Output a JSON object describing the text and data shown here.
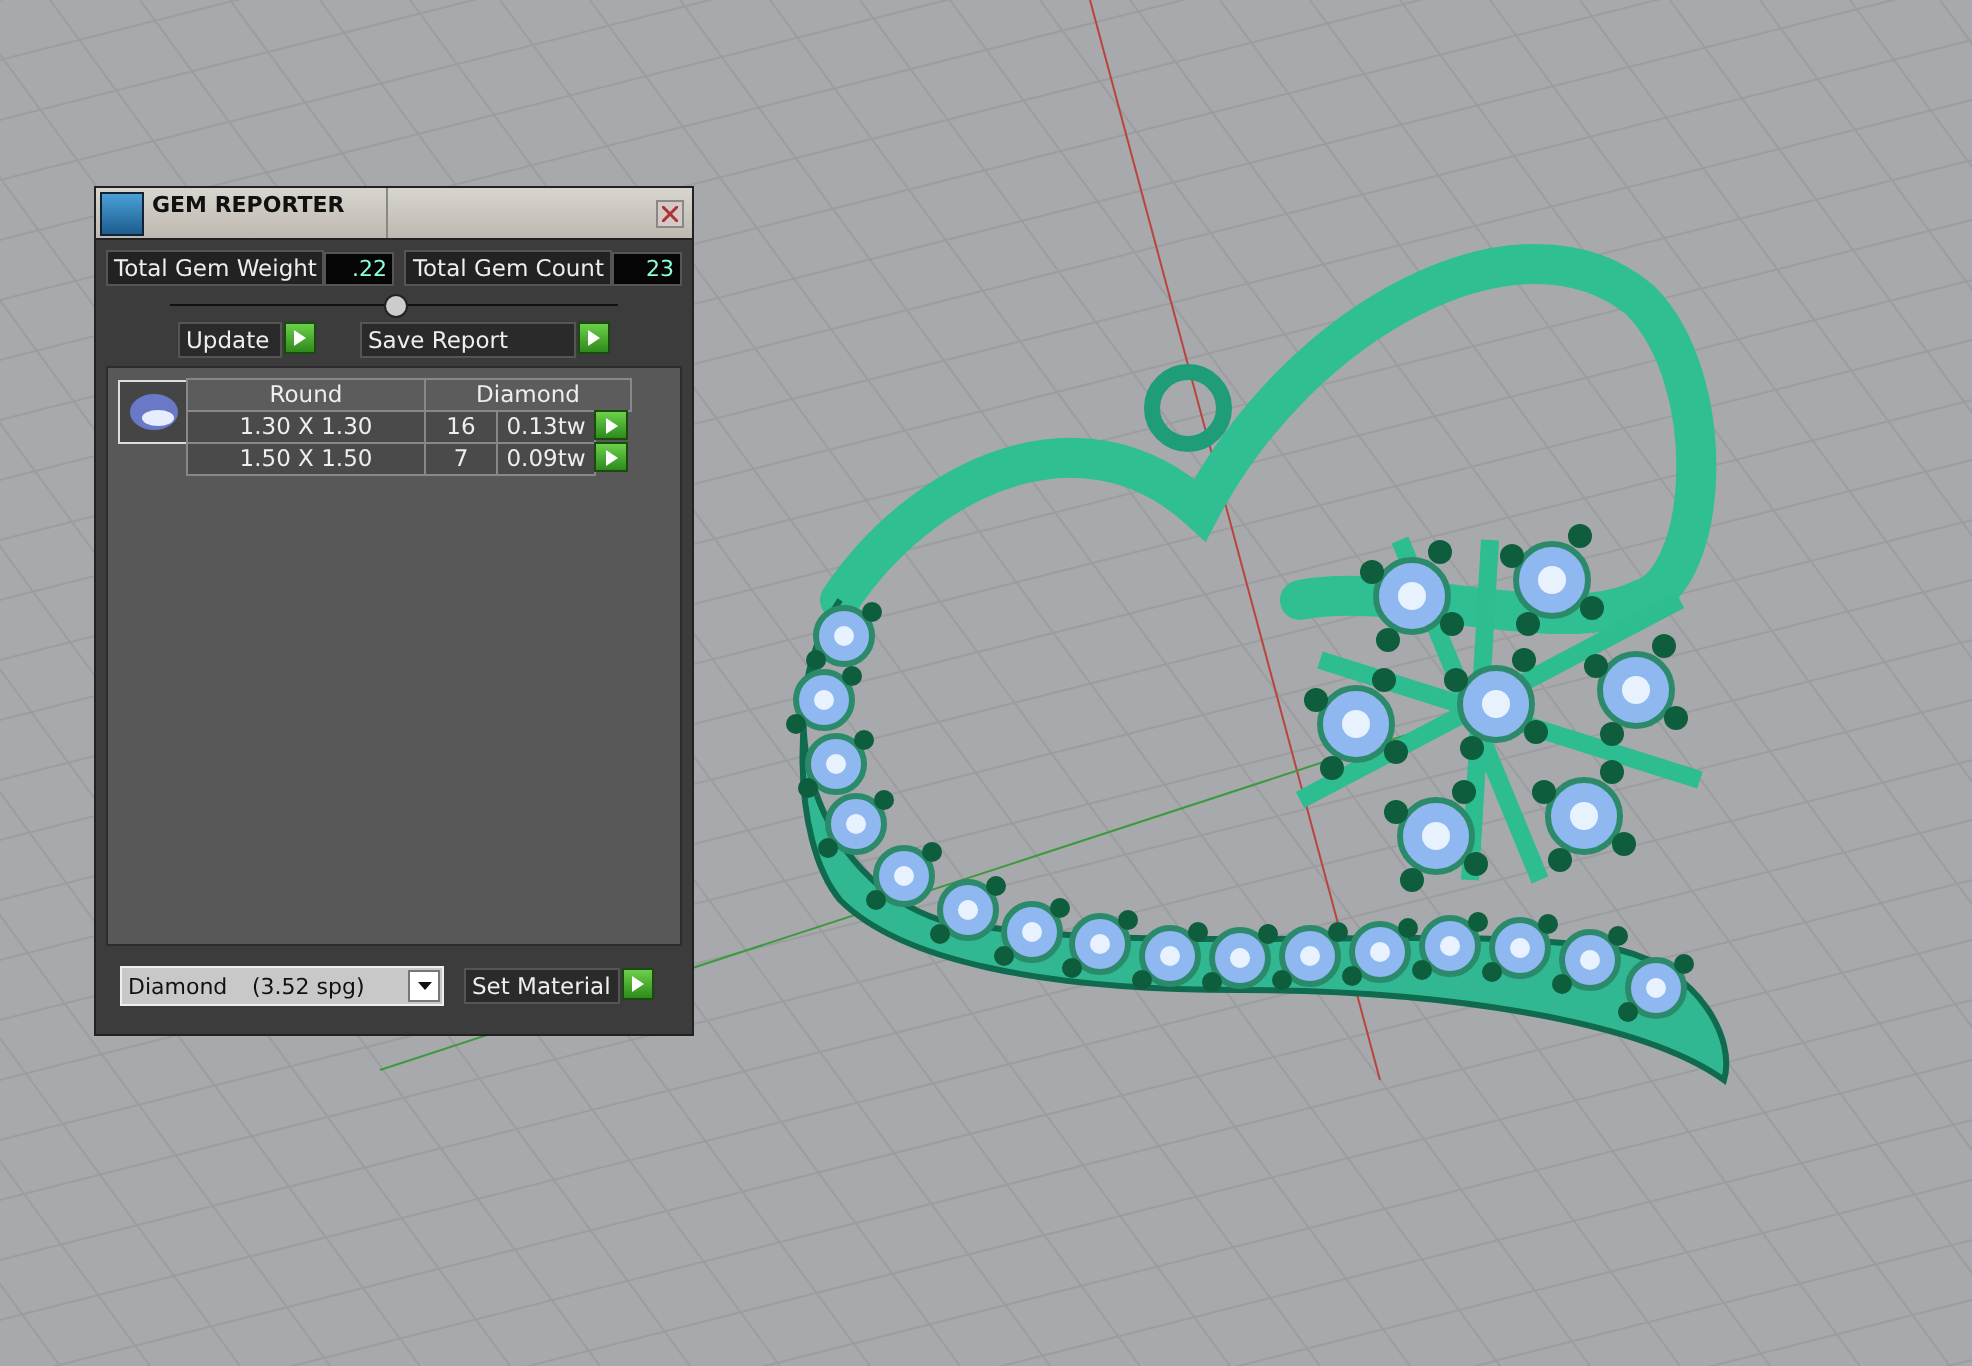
{
  "panel": {
    "title": "GEM REPORTER",
    "stats": [
      {
        "label": "Total Gem Weight",
        "value": ".22"
      },
      {
        "label": "Total Gem Count",
        "value": "23"
      }
    ],
    "actions": [
      {
        "label": "Update"
      },
      {
        "label": "Save Report"
      }
    ],
    "table": {
      "columns": [
        "Round",
        "Diamond"
      ],
      "rows": [
        {
          "size": "1.30 X 1.30",
          "count": "16",
          "weight": "0.13tw"
        },
        {
          "size": "1.50 X 1.50",
          "count": "7",
          "weight": "0.09tw"
        }
      ]
    },
    "material": {
      "name": "Diamond",
      "density": "(3.52 spg)"
    },
    "set_button": "Set Material"
  }
}
